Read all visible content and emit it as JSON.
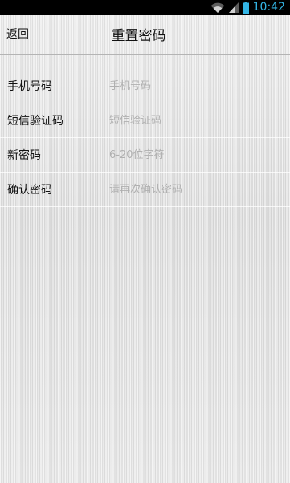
{
  "status_bar": {
    "time": "10:42",
    "icons": [
      "wifi-icon",
      "signal-icon",
      "battery-icon"
    ],
    "accent_color": "#33b5e5"
  },
  "header": {
    "back_label": "返回",
    "title": "重置密码"
  },
  "form": {
    "fields": [
      {
        "label": "手机号码",
        "placeholder": "手机号码",
        "value": ""
      },
      {
        "label": "短信验证码",
        "placeholder": "短信验证码",
        "value": ""
      },
      {
        "label": "新密码",
        "placeholder": "6-20位字符",
        "value": ""
      },
      {
        "label": "确认密码",
        "placeholder": "请再次确认密码",
        "value": ""
      }
    ]
  }
}
